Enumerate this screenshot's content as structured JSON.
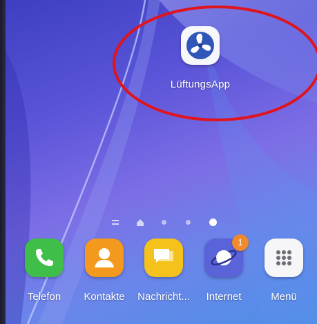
{
  "home_screen": {
    "featured_app": {
      "label": "LüftungsApp",
      "icon": "fan-icon",
      "icon_color": "#2f56b8",
      "annotation_color": "#e0141c"
    },
    "page_indicator": {
      "pages": [
        "menu-lines",
        "home",
        "dot",
        "dot",
        "dot"
      ],
      "active_index": 4
    },
    "dock": [
      {
        "label": "Telefon",
        "icon": "phone-icon",
        "color": "#3fbf4a"
      },
      {
        "label": "Kontakte",
        "icon": "contacts-icon",
        "color": "#f39a1e"
      },
      {
        "label": "Nachricht...",
        "icon": "messages-icon",
        "color": "#f4c21a"
      },
      {
        "label": "Internet",
        "icon": "internet-icon",
        "color": "#5b63d8",
        "badge": "1",
        "badge_color": "#f08a2c"
      },
      {
        "label": "Menü",
        "icon": "apps-grid-icon",
        "color": "#f6f6f8"
      }
    ]
  }
}
